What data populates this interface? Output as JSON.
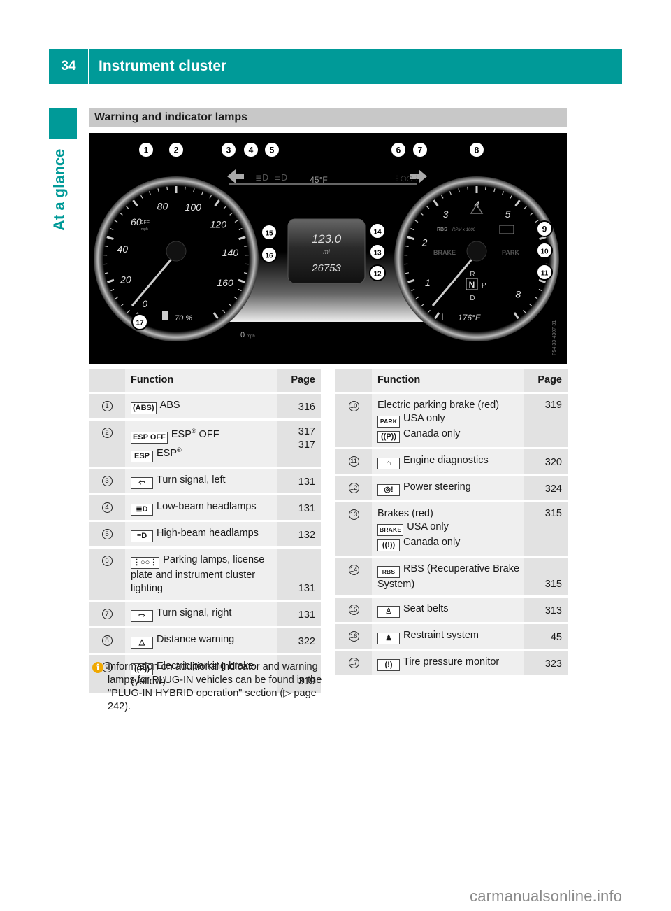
{
  "header": {
    "page_number": "34",
    "title": "Instrument cluster"
  },
  "side_label": "At a glance",
  "section_title": "Warning and indicator lamps",
  "cluster": {
    "speed_ticks": [
      "0",
      "20",
      "40",
      "60",
      "80",
      "100",
      "120",
      "140",
      "160"
    ],
    "rpm_ticks": [
      "1",
      "2",
      "3",
      "4",
      "5",
      "8"
    ],
    "outside_temp": "45°F",
    "trip": "123.0",
    "trip_unit": "mi",
    "odometer": "26753",
    "speed_readout": "0",
    "speed_unit": "mph",
    "fuel_level": "70 %",
    "coolant_temp": "176°F",
    "rpm_label": "RPM x 1000",
    "esp_off_label": "OFF",
    "esp_unit": "mph",
    "gear_indicator": {
      "upper": "R",
      "current": "N",
      "right": "P",
      "lower": "D"
    },
    "lamp_labels": {
      "rbs": "RBS",
      "brake": "BRAKE",
      "park": "PARK"
    },
    "image_code": "P54.33-4307-31",
    "callouts": [
      "1",
      "2",
      "3",
      "4",
      "5",
      "6",
      "7",
      "8",
      "9",
      "10",
      "11",
      "12",
      "13",
      "14",
      "15",
      "16",
      "17"
    ]
  },
  "tables": [
    {
      "headers": {
        "num": "",
        "function": "Function",
        "page": "Page"
      },
      "rows": [
        {
          "num": "1",
          "lines": [
            {
              "icon": "abs-icon",
              "icon_glyph": "(ABS)",
              "text": "ABS",
              "page": "316"
            }
          ]
        },
        {
          "num": "2",
          "lines": [
            {
              "icon": "esp-off-icon",
              "icon_glyph": "ESP OFF",
              "text": "ESP® OFF",
              "page": "317"
            },
            {
              "icon": "esp-icon",
              "icon_glyph": "ESP",
              "text": "ESP®",
              "page": "317"
            }
          ]
        },
        {
          "num": "3",
          "lines": [
            {
              "icon": "turn-left-icon",
              "icon_glyph": "⇦",
              "text": "Turn signal, left",
              "page": "131"
            }
          ]
        },
        {
          "num": "4",
          "lines": [
            {
              "icon": "low-beam-icon",
              "icon_glyph": "≣D",
              "text": "Low-beam headlamps",
              "page": "131"
            }
          ]
        },
        {
          "num": "5",
          "lines": [
            {
              "icon": "high-beam-icon",
              "icon_glyph": "≡D",
              "text": "High-beam headlamps",
              "page": "132"
            }
          ]
        },
        {
          "num": "6",
          "lines": [
            {
              "icon": "parking-lamps-icon",
              "icon_glyph": "⋮○○⋮",
              "text": "Parking lamps, license plate and instrument cluster lighting",
              "page": "131"
            }
          ]
        },
        {
          "num": "7",
          "lines": [
            {
              "icon": "turn-right-icon",
              "icon_glyph": "⇨",
              "text": "Turn signal, right",
              "page": "131"
            }
          ]
        },
        {
          "num": "8",
          "lines": [
            {
              "icon": "distance-warning-icon",
              "icon_glyph": "△",
              "text": "Distance warning",
              "page": "322"
            }
          ]
        },
        {
          "num": "9",
          "lines": [
            {
              "icon": "parking-brake-icon",
              "icon_glyph": "((P))",
              "text": "Electric parking brake (yellow)",
              "page": "319"
            }
          ]
        }
      ]
    },
    {
      "headers": {
        "num": "",
        "function": "Function",
        "page": "Page"
      },
      "rows": [
        {
          "num": "10",
          "lines": [
            {
              "icon": null,
              "icon_glyph": "",
              "text": "Electric parking brake (red)",
              "page": "319"
            },
            {
              "icon": "park-text-icon",
              "icon_glyph": "PARK",
              "text": "USA only",
              "page": ""
            },
            {
              "icon": "parking-brake-icon",
              "icon_glyph": "((P))",
              "text": "Canada only",
              "page": ""
            }
          ]
        },
        {
          "num": "11",
          "lines": [
            {
              "icon": "engine-icon",
              "icon_glyph": "⌂",
              "text": "Engine diagnostics",
              "page": "320"
            }
          ]
        },
        {
          "num": "12",
          "lines": [
            {
              "icon": "power-steering-icon",
              "icon_glyph": "◎!",
              "text": "Power steering",
              "page": "324"
            }
          ]
        },
        {
          "num": "13",
          "lines": [
            {
              "icon": null,
              "icon_glyph": "",
              "text": "Brakes (red)",
              "page": "315"
            },
            {
              "icon": "brake-text-icon",
              "icon_glyph": "BRAKE",
              "text": "USA only",
              "page": ""
            },
            {
              "icon": "brake-warning-icon",
              "icon_glyph": "((!))",
              "text": "Canada only",
              "page": ""
            }
          ]
        },
        {
          "num": "14",
          "lines": [
            {
              "icon": "rbs-icon",
              "icon_glyph": "RBS",
              "text": "RBS (Recuperative Brake System)",
              "page": "315"
            }
          ]
        },
        {
          "num": "15",
          "lines": [
            {
              "icon": "seat-belt-icon",
              "icon_glyph": "♙",
              "text": "Seat belts",
              "page": "313"
            }
          ]
        },
        {
          "num": "16",
          "lines": [
            {
              "icon": "restraint-system-icon",
              "icon_glyph": "♟",
              "text": "Restraint system",
              "page": "45"
            }
          ]
        },
        {
          "num": "17",
          "lines": [
            {
              "icon": "tire-pressure-icon",
              "icon_glyph": "(!)",
              "text": "Tire pressure monitor",
              "page": "323"
            }
          ]
        }
      ]
    }
  ],
  "note": {
    "icon": "info-icon",
    "text": "Information on additional indicator and warning lamps for PLUG-IN vehicles can be found in the \"PLUG-IN HYBRID operation\" section (",
    "ref_arrow": "▷",
    "ref_text": " page 242)."
  },
  "watermark": "carmanualsonline.info",
  "colors": {
    "brand": "#009a98",
    "section_bar": "#c8c8c8",
    "table_dark": "#e2e2e2",
    "table_light": "#efefef",
    "info": "#f0a800"
  }
}
